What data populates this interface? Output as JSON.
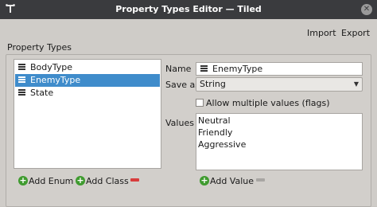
{
  "window": {
    "title": "Property Types Editor — Tiled",
    "icon": "tiled-logo-icon",
    "close_icon": "close-icon"
  },
  "toolbar": {
    "import_label": "Import",
    "export_label": "Export"
  },
  "group": {
    "label": "Property Types"
  },
  "types": [
    {
      "label": "BodyType",
      "icon": "class-icon",
      "selected": false
    },
    {
      "label": "EnemyType",
      "icon": "enum-icon",
      "selected": true
    },
    {
      "label": "State",
      "icon": "enum-icon",
      "selected": false
    }
  ],
  "editor": {
    "name_label": "Name",
    "name_value": "EnemyType",
    "save_as_label": "Save as",
    "save_as_value": "String",
    "flags_label": "Allow multiple values (flags)",
    "flags_checked": false,
    "values_label": "Values",
    "values": [
      "Neutral",
      "Friendly",
      "Aggressive"
    ]
  },
  "actions": {
    "add_enum": "Add Enum",
    "add_class": "Add Class",
    "add_value": "Add Value"
  },
  "colors": {
    "titlebar": "#3a3b3e",
    "selection": "#3f8ccb",
    "add_green": "#3f9b2f",
    "remove_red": "#d83c3c",
    "remove_disabled": "#a8a6a3"
  }
}
